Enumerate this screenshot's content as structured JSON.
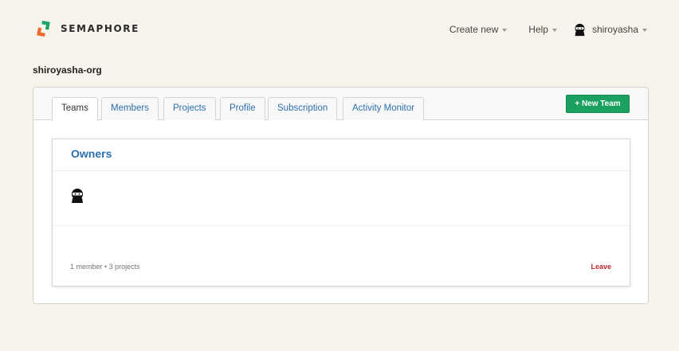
{
  "brand": {
    "name": "SEMAPHORE"
  },
  "topnav": {
    "create_label": "Create new",
    "help_label": "Help",
    "user_name": "shiroyasha"
  },
  "org": {
    "name": "shiroyasha-org"
  },
  "tabs": [
    {
      "label": "Teams",
      "active": true
    },
    {
      "label": "Members",
      "active": false
    },
    {
      "label": "Projects",
      "active": false
    },
    {
      "label": "Profile",
      "active": false
    },
    {
      "label": "Subscription",
      "active": false
    },
    {
      "label": "Activity Monitor",
      "active": false
    }
  ],
  "actions": {
    "new_team_label": "+ New Team"
  },
  "team": {
    "name": "Owners",
    "meta": "1 member • 3 projects",
    "leave_label": "Leave"
  },
  "colors": {
    "accent_link": "#2d6fb0",
    "button_green": "#1aa15f",
    "leave_red": "#c0282e",
    "background": "#f6f3ec"
  },
  "icons": {
    "logo": "semaphore-logo-icon",
    "avatar": "ninja-avatar-icon",
    "caret": "caret-down-icon"
  }
}
